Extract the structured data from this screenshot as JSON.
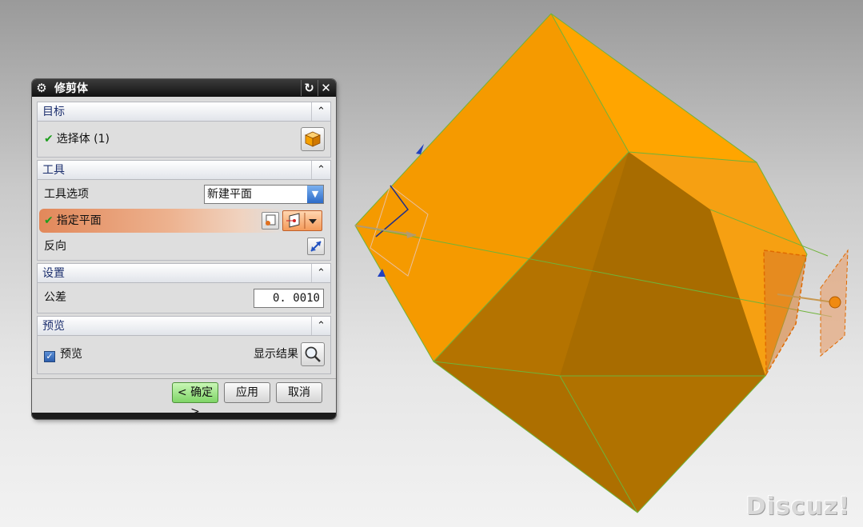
{
  "dialog": {
    "title": "修剪体",
    "sections": {
      "target": {
        "header": "目标",
        "select_body_label": "选择体 (1)"
      },
      "tool": {
        "header": "工具",
        "tool_option_label": "工具选项",
        "tool_option_value": "新建平面",
        "specify_plane_label": "指定平面",
        "reverse_label": "反向"
      },
      "settings": {
        "header": "设置",
        "tolerance_label": "公差",
        "tolerance_value": "0. 0010"
      },
      "preview": {
        "header": "预览",
        "preview_label": "预览",
        "show_result_label": "显示结果"
      }
    },
    "buttons": {
      "ok": "< 确定 >",
      "apply": "应用",
      "cancel": "取消"
    }
  },
  "preview_checked": true,
  "colors": {
    "body_orange": "#f59a00",
    "body_dark": "#b07200",
    "plane_edge": "#e06a00"
  },
  "watermark": "Discuz!"
}
